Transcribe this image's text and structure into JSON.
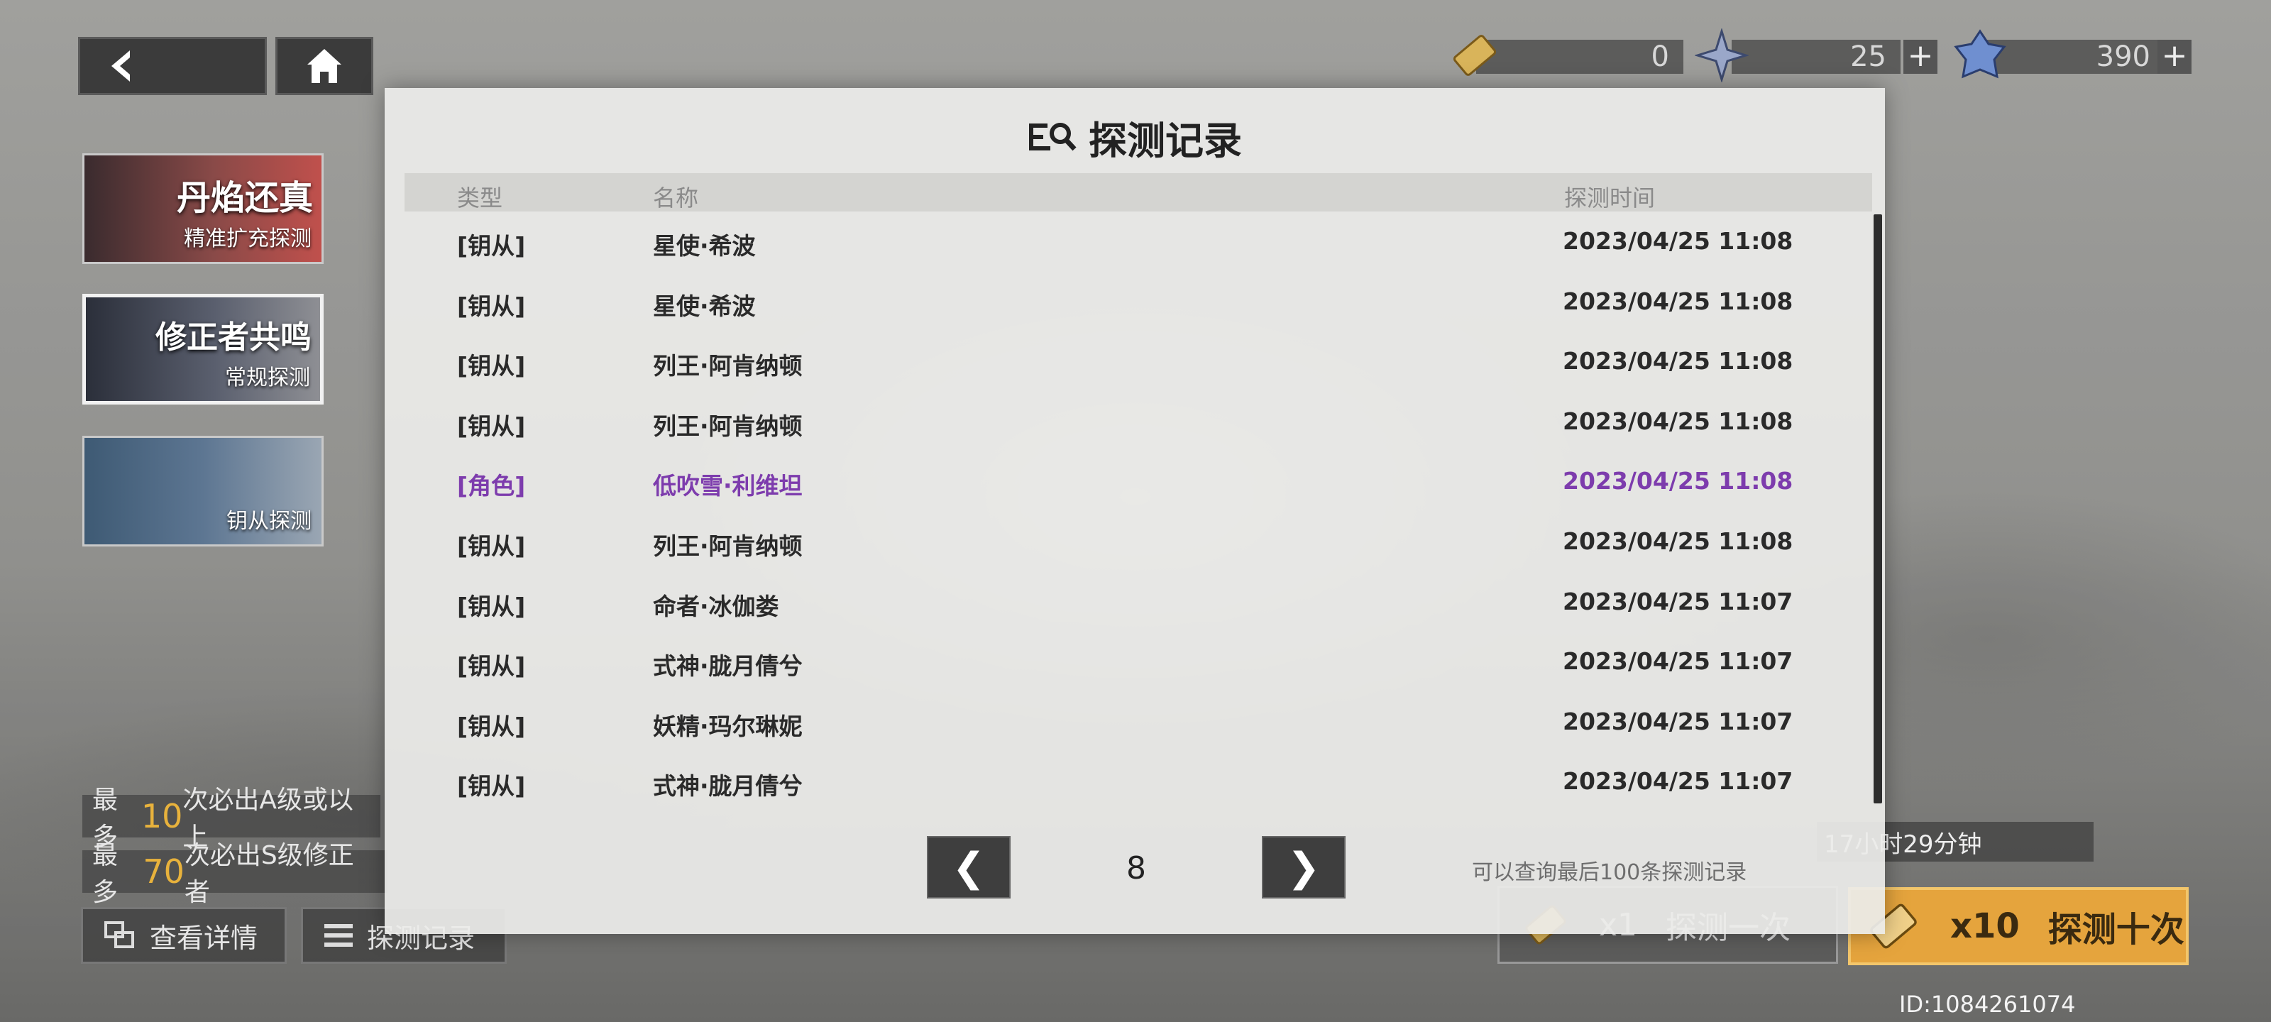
{
  "currencies": [
    {
      "icon": "ticket-icon",
      "value": "0"
    },
    {
      "icon": "star-crystal-icon",
      "value": "25"
    },
    {
      "icon": "blue-crystal-icon",
      "value": "390"
    }
  ],
  "banners": [
    {
      "title": "丹焰还真",
      "label": "精准扩充探测"
    },
    {
      "title": "修正者共鸣",
      "label": "常规探测"
    },
    {
      "title": "",
      "label": "钥从探测"
    }
  ],
  "info": {
    "line1_pre": "最多",
    "line1_num": "10",
    "line1_post": "次必出A级或以上",
    "line2_pre": "最多",
    "line2_num": "70",
    "line2_post": "次必出S级修正者"
  },
  "buttons": {
    "details": "查看详情",
    "records": "探测记录",
    "pull_one_count": "x1",
    "pull_one_label": "探测一次",
    "pull_ten_count": "x10",
    "pull_ten_label": "探测十次"
  },
  "timer": "17小时29分钟",
  "uid": "ID:1084261074",
  "modal": {
    "title": "探测记录",
    "columns": {
      "type": "类型",
      "name": "名称",
      "time": "探测时间"
    },
    "rows": [
      {
        "type": "[钥从]",
        "name": "星使·希波",
        "time": "2023/04/25 11:08"
      },
      {
        "type": "[钥从]",
        "name": "星使·希波",
        "time": "2023/04/25 11:08"
      },
      {
        "type": "[钥从]",
        "name": "列王·阿肯纳顿",
        "time": "2023/04/25 11:08"
      },
      {
        "type": "[钥从]",
        "name": "列王·阿肯纳顿",
        "time": "2023/04/25 11:08"
      },
      {
        "type": "[角色]",
        "name": "低吹雪·利维坦",
        "time": "2023/04/25 11:08"
      },
      {
        "type": "[钥从]",
        "name": "列王·阿肯纳顿",
        "time": "2023/04/25 11:08"
      },
      {
        "type": "[钥从]",
        "name": "命者·冰伽娄",
        "time": "2023/04/25 11:07"
      },
      {
        "type": "[钥从]",
        "name": "式神·胧月倩兮",
        "time": "2023/04/25 11:07"
      },
      {
        "type": "[钥从]",
        "name": "妖精·玛尔琳妮",
        "time": "2023/04/25 11:07"
      },
      {
        "type": "[钥从]",
        "name": "式神·胧月倩兮",
        "time": "2023/04/25 11:07"
      }
    ],
    "page": "8",
    "note": "可以查询最后100条探测记录",
    "prev": "❮",
    "next": "❯",
    "role_color": "#7d3cad"
  }
}
